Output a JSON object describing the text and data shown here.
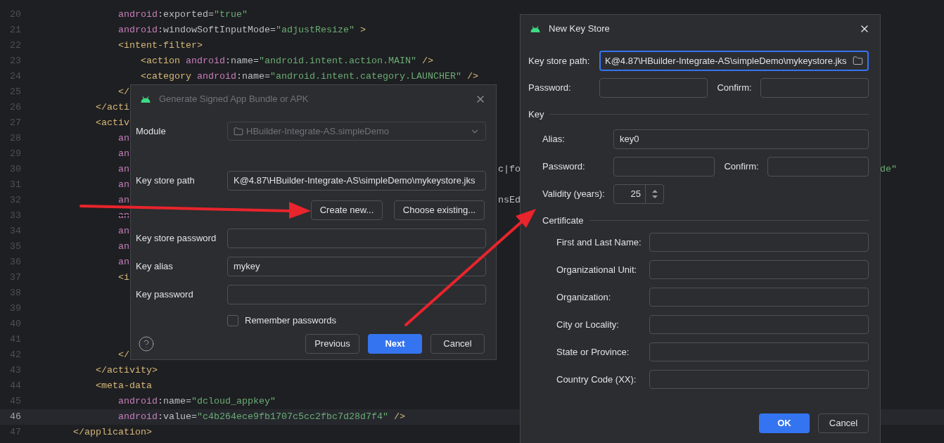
{
  "editor": {
    "lines": [
      {
        "number": "20",
        "struck": false,
        "current": false,
        "tokens": [
          {
            "kind": "ns",
            "text": "            android"
          },
          {
            "kind": "attr",
            "text": ":exported="
          },
          {
            "kind": "str",
            "text": "\"true\""
          }
        ]
      },
      {
        "number": "21",
        "struck": false,
        "current": false,
        "tokens": [
          {
            "kind": "ns",
            "text": "            android"
          },
          {
            "kind": "attr",
            "text": ":windowSoftInputMode="
          },
          {
            "kind": "str",
            "text": "\"adjustResize\""
          },
          {
            "kind": "tag",
            "text": " >"
          }
        ]
      },
      {
        "number": "22",
        "struck": false,
        "current": false,
        "tokens": [
          {
            "kind": "tag",
            "text": "            <intent-filter>"
          }
        ]
      },
      {
        "number": "23",
        "struck": false,
        "current": false,
        "tokens": [
          {
            "kind": "tag",
            "text": "                <action "
          },
          {
            "kind": "ns",
            "text": "android"
          },
          {
            "kind": "attr",
            "text": ":name="
          },
          {
            "kind": "str",
            "text": "\"android.intent.action.MAIN\""
          },
          {
            "kind": "tag",
            "text": " />"
          }
        ]
      },
      {
        "number": "24",
        "struck": false,
        "current": false,
        "tokens": [
          {
            "kind": "tag",
            "text": "                <category "
          },
          {
            "kind": "ns",
            "text": "android"
          },
          {
            "kind": "attr",
            "text": ":name="
          },
          {
            "kind": "str",
            "text": "\"android.intent.category.LAUNCHER\""
          },
          {
            "kind": "tag",
            "text": " />"
          }
        ]
      },
      {
        "number": "25",
        "struck": false,
        "current": false,
        "tokens": [
          {
            "kind": "tag",
            "text": "            </"
          }
        ]
      },
      {
        "number": "26",
        "struck": false,
        "current": false,
        "tokens": [
          {
            "kind": "tag",
            "text": "        </acti"
          }
        ]
      },
      {
        "number": "27",
        "struck": false,
        "current": false,
        "tokens": [
          {
            "kind": "tag",
            "text": "        <activ"
          }
        ]
      },
      {
        "number": "28",
        "struck": false,
        "current": false,
        "tokens": [
          {
            "kind": "ns",
            "text": "            an"
          }
        ]
      },
      {
        "number": "29",
        "struck": false,
        "current": false,
        "tokens": [
          {
            "kind": "ns",
            "text": "            an"
          }
        ]
      },
      {
        "number": "30",
        "struck": false,
        "current": false,
        "tokens": [
          {
            "kind": "ns",
            "text": "            an"
          }
        ],
        "middle": "c|fo",
        "right": "de\""
      },
      {
        "number": "31",
        "struck": false,
        "current": false,
        "tokens": [
          {
            "kind": "ns",
            "text": "            an"
          }
        ]
      },
      {
        "number": "32",
        "struck": false,
        "current": false,
        "tokens": [
          {
            "kind": "ns",
            "text": "            an"
          }
        ],
        "middle": "nsEd"
      },
      {
        "number": "33",
        "struck": true,
        "current": false,
        "tokens": [
          {
            "kind": "ns",
            "text": "            an"
          }
        ]
      },
      {
        "number": "34",
        "struck": false,
        "current": false,
        "tokens": [
          {
            "kind": "ns",
            "text": "            an"
          }
        ]
      },
      {
        "number": "35",
        "struck": false,
        "current": false,
        "tokens": [
          {
            "kind": "ns",
            "text": "            an"
          }
        ]
      },
      {
        "number": "36",
        "struck": false,
        "current": false,
        "tokens": [
          {
            "kind": "ns",
            "text": "            an"
          }
        ]
      },
      {
        "number": "37",
        "struck": false,
        "current": false,
        "tokens": [
          {
            "kind": "tag",
            "text": "            <i"
          }
        ]
      },
      {
        "number": "38",
        "struck": false,
        "current": false
      },
      {
        "number": "39",
        "struck": false,
        "current": false
      },
      {
        "number": "40",
        "struck": false,
        "current": false
      },
      {
        "number": "41",
        "struck": false,
        "current": false
      },
      {
        "number": "42",
        "struck": false,
        "current": false,
        "tokens": [
          {
            "kind": "tag",
            "text": "            </"
          }
        ]
      },
      {
        "number": "43",
        "struck": false,
        "current": false,
        "tokens": [
          {
            "kind": "tag",
            "text": "        </activity>"
          }
        ]
      },
      {
        "number": "44",
        "struck": false,
        "current": false,
        "tokens": [
          {
            "kind": "tag",
            "text": "        <meta-data"
          }
        ]
      },
      {
        "number": "45",
        "struck": false,
        "current": false,
        "tokens": [
          {
            "kind": "ns",
            "text": "            android"
          },
          {
            "kind": "attr",
            "text": ":name="
          },
          {
            "kind": "str",
            "text": "\"dcloud_appkey\""
          }
        ]
      },
      {
        "number": "46",
        "struck": false,
        "current": true,
        "tokens": [
          {
            "kind": "ns",
            "text": "            android"
          },
          {
            "kind": "attr",
            "text": ":value="
          },
          {
            "kind": "str",
            "text": "\"c4b264ece9fb1707c5cc2fbc7d28d7f4\""
          },
          {
            "kind": "tag",
            "text": " />"
          }
        ]
      },
      {
        "number": "47",
        "struck": false,
        "current": false,
        "tokens": [
          {
            "kind": "tag",
            "text": "    </application>"
          }
        ]
      }
    ]
  },
  "signed_dialog": {
    "title": "Generate Signed App Bundle or APK",
    "active": false,
    "module": {
      "label": "Module",
      "value": "HBuilder-Integrate-AS.simpleDemo",
      "disabled": true
    },
    "key_store_path": {
      "label": "Key store path",
      "value": "K@4.87\\HBuilder-Integrate-AS\\simpleDemo\\mykeystore.jks"
    },
    "path_buttons": [
      "Create new...",
      "Choose existing..."
    ],
    "key_store_password": {
      "label": "Key store password"
    },
    "key_alias": {
      "label": "Key alias",
      "value": "mykey"
    },
    "key_password": {
      "label": "Key password"
    },
    "remember_passwords": {
      "label": "Remember passwords",
      "checked": false
    },
    "buttons": [
      {
        "label": "Previous",
        "primary": false
      },
      {
        "label": "Next",
        "primary": true
      },
      {
        "label": "Cancel",
        "primary": false
      }
    ]
  },
  "keystore_dialog": {
    "title": "New Key Store",
    "active": true,
    "key_store_path": {
      "label": "Key store path:",
      "value": "K@4.87\\HBuilder-Integrate-AS\\simpleDemo\\mykeystore.jks",
      "focused": true
    },
    "password": {
      "label": "Password:"
    },
    "confirm": {
      "label": "Confirm:"
    },
    "key_section": "Key",
    "alias": {
      "label": "Alias:",
      "value": "key0"
    },
    "key_password": {
      "label": "Password:"
    },
    "key_confirm": {
      "label": "Confirm:"
    },
    "validity": {
      "label": "Validity (years):",
      "value": "25"
    },
    "certificate_section": "Certificate",
    "certificate_fields": [
      {
        "label": "First and Last Name:"
      },
      {
        "label": "Organizational Unit:"
      },
      {
        "label": "Organization:"
      },
      {
        "label": "City or Locality:"
      },
      {
        "label": "State or Province:"
      },
      {
        "label": "Country Code (XX):"
      }
    ],
    "buttons": [
      {
        "label": "OK",
        "primary": true
      },
      {
        "label": "Cancel",
        "primary": false
      }
    ]
  }
}
